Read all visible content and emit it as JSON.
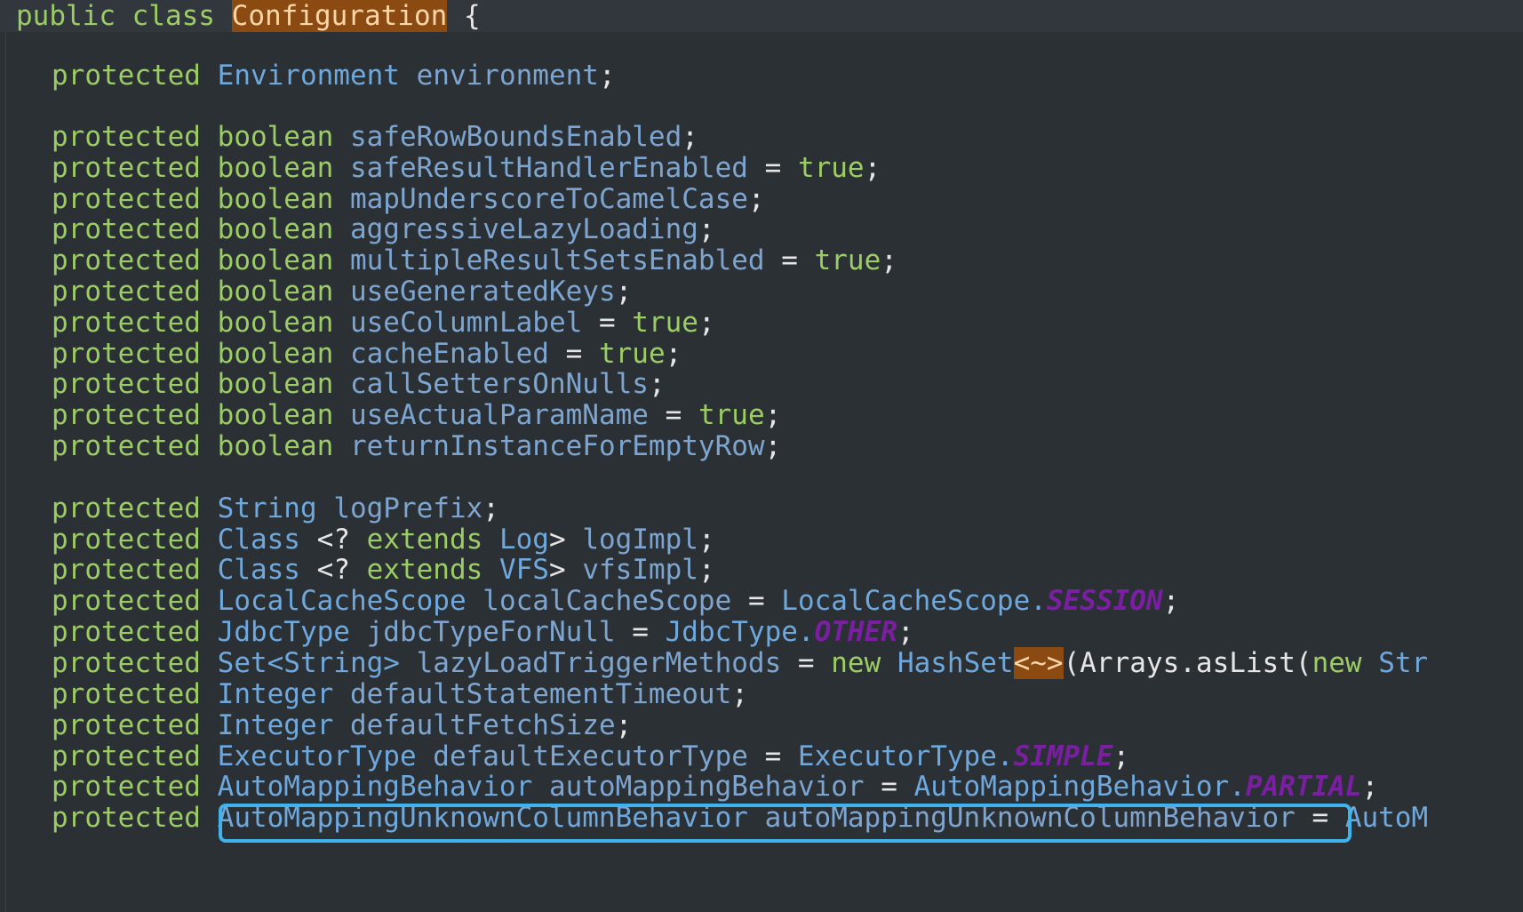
{
  "colors": {
    "background": "#2b3035",
    "keyword": "#9ccc65",
    "type": "#6fa8dc",
    "constant": "#7a1fa2",
    "highlight": "#8b4a12",
    "selection_box": "#3eb3ee"
  },
  "code": {
    "class_line": {
      "kw1": "public",
      "kw2": "class",
      "name": "Configuration",
      "brace": "{"
    },
    "env": {
      "kw": "protected",
      "type": "Environment",
      "name": "environment",
      "end": ";"
    },
    "booleans": [
      {
        "name": "safeRowBoundsEnabled",
        "init": "",
        "end": ";"
      },
      {
        "name": "safeResultHandlerEnabled",
        "init": "true",
        "end": ";"
      },
      {
        "name": "mapUnderscoreToCamelCase",
        "init": "",
        "end": ";"
      },
      {
        "name": "aggressiveLazyLoading",
        "init": "",
        "end": ";"
      },
      {
        "name": "multipleResultSetsEnabled",
        "init": "true",
        "end": ";"
      },
      {
        "name": "useGeneratedKeys",
        "init": "",
        "end": ";"
      },
      {
        "name": "useColumnLabel",
        "init": "true",
        "end": ";"
      },
      {
        "name": "cacheEnabled",
        "init": "true",
        "end": ";"
      },
      {
        "name": "callSettersOnNulls",
        "init": "",
        "end": ";"
      },
      {
        "name": "useActualParamName",
        "init": "true",
        "end": ";"
      },
      {
        "name": "returnInstanceForEmptyRow",
        "init": "",
        "end": ";"
      }
    ],
    "protected_kw": "protected",
    "boolean_kw": "boolean",
    "eq": "=",
    "fields2": {
      "logPrefix": {
        "type": "String",
        "name": "logPrefix",
        "end": ";"
      },
      "logImpl": {
        "type": "Class",
        "generic_open": "<?",
        "extends": "extends",
        "bound": "Log",
        "generic_close": ">",
        "name": "logImpl",
        "end": ";"
      },
      "vfsImpl": {
        "type": "Class",
        "generic_open": "<?",
        "extends": "extends",
        "bound": "VFS",
        "generic_close": ">",
        "name": "vfsImpl",
        "end": ";"
      },
      "localCacheScope": {
        "type": "LocalCacheScope",
        "name": "localCacheScope",
        "qual": "LocalCacheScope.",
        "const": "SESSION",
        "end": ";"
      },
      "jdbcTypeForNull": {
        "type": "JdbcType",
        "name": "jdbcTypeForNull",
        "qual": "JdbcType.",
        "const": "OTHER",
        "end": ";"
      },
      "lazyLoad": {
        "type": "Set<String>",
        "name": "lazyLoadTriggerMethods",
        "new_kw": "new",
        "ctor": "HashSet",
        "diamond": "<~>",
        "args": "(Arrays.asList(",
        "new_kw2": "new",
        "tail": "Str"
      },
      "defaultStatementTimeout": {
        "type": "Integer",
        "name": "defaultStatementTimeout",
        "end": ";"
      },
      "defaultFetchSize": {
        "type": "Integer",
        "name": "defaultFetchSize",
        "end": ";"
      },
      "defaultExecutorType": {
        "type": "ExecutorType",
        "name": "defaultExecutorType",
        "qual": "ExecutorType.",
        "const": "SIMPLE",
        "end": ";"
      },
      "autoMappingBehavior": {
        "type": "AutoMappingBehavior",
        "name": "autoMappingBehavior",
        "qual": "AutoMappingBehavior.",
        "const": "PARTIAL",
        "end": ";"
      },
      "autoMappingUnknown": {
        "type": "AutoMappingUnknownColumnBehavior",
        "name": "autoMappingUnknownColumnBehavior",
        "tail": "AutoM"
      }
    }
  }
}
